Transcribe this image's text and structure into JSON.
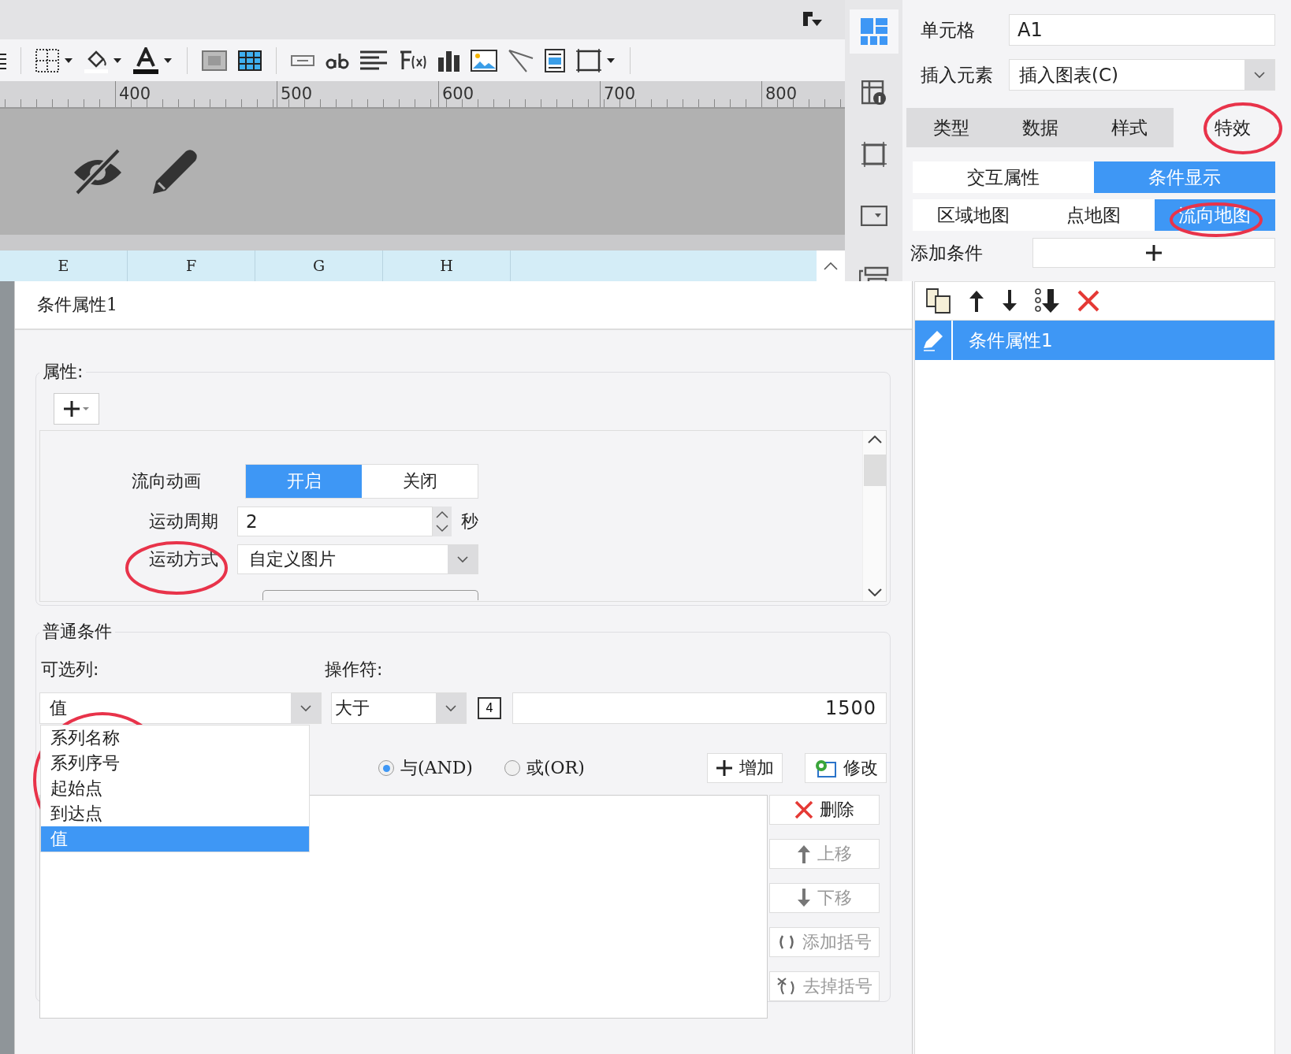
{
  "ruler": {
    "ticks": [
      "400",
      "500",
      "600",
      "700",
      "800"
    ]
  },
  "column_headers": [
    "E",
    "F",
    "G",
    "H"
  ],
  "side_panel": {
    "cell": {
      "label": "单元格",
      "value": "A1"
    },
    "insert_element": {
      "label": "插入元素",
      "value": "插入图表(C)"
    },
    "tabs": [
      {
        "label": "类型",
        "selected": false
      },
      {
        "label": "数据",
        "selected": false
      },
      {
        "label": "样式",
        "selected": false
      },
      {
        "label": "特效",
        "selected": true
      }
    ],
    "effect_tabs": [
      {
        "label": "交互属性",
        "selected": false
      },
      {
        "label": "条件显示",
        "selected": true
      }
    ],
    "map_tabs": [
      {
        "label": "区域地图",
        "selected": false
      },
      {
        "label": "点地图",
        "selected": false
      },
      {
        "label": "流向地图",
        "selected": true
      }
    ],
    "add_condition": {
      "label": "添加条件"
    },
    "conditions": [
      {
        "label": "条件属性1",
        "selected": true
      }
    ]
  },
  "dialog": {
    "title": "条件属性1",
    "properties": {
      "legend": "属性:",
      "flow_animation": {
        "label": "流向动画",
        "options": [
          {
            "label": "开启",
            "selected": true
          },
          {
            "label": "关闭",
            "selected": false
          }
        ]
      },
      "period": {
        "label": "运动周期",
        "value": "2",
        "unit": "秒"
      },
      "motion": {
        "label": "运动方式",
        "value": "自定义图片"
      }
    },
    "conditions": {
      "legend": "普通条件",
      "column_label": "可选列:",
      "operator_label": "操作符:",
      "column_value": "值",
      "operator_value": "大于",
      "value_type": "4",
      "value": "1500",
      "column_options": [
        {
          "label": "系列名称",
          "selected": false
        },
        {
          "label": "系列序号",
          "selected": false
        },
        {
          "label": "起始点",
          "selected": false
        },
        {
          "label": "到达点",
          "selected": false
        },
        {
          "label": "值",
          "selected": true
        }
      ],
      "logic": [
        {
          "label": "与(AND)",
          "selected": true
        },
        {
          "label": "或(OR)",
          "selected": false
        }
      ],
      "buttons": [
        {
          "label": "增加",
          "kind": "add"
        },
        {
          "label": "修改",
          "kind": "edit"
        }
      ],
      "side_buttons": [
        {
          "label": "删除",
          "kind": "delete",
          "disabled": false
        },
        {
          "label": "上移",
          "kind": "up",
          "disabled": true
        },
        {
          "label": "下移",
          "kind": "down",
          "disabled": true
        },
        {
          "label": "添加括号",
          "kind": "add-brackets",
          "disabled": true
        },
        {
          "label": "去掉括号",
          "kind": "remove-brackets",
          "disabled": true
        }
      ]
    }
  }
}
